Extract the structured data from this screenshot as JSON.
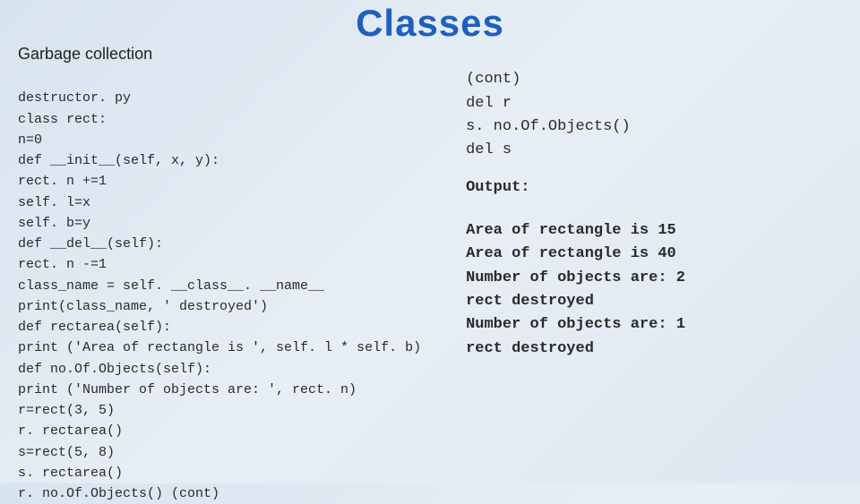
{
  "slide": {
    "title": "Classes"
  },
  "left": {
    "heading": "Garbage collection",
    "code": [
      "destructor. py",
      "class rect:",
      "n=0",
      "def __init__(self, x, y):",
      "rect. n +=1",
      "self. l=x",
      "self. b=y",
      "def __del__(self):",
      "rect. n -=1",
      "class_name = self. __class__. __name__",
      "print(class_name, ' destroyed')",
      "def rectarea(self):",
      "print ('Area of rectangle is ', self. l * self. b)",
      "def no.Of.Objects(self):",
      "print ('Number of objects are: ', rect. n)",
      "r=rect(3, 5)",
      "r. rectarea()",
      "s=rect(5, 8)",
      "s. rectarea()",
      "r. no.Of.Objects() (cont)"
    ]
  },
  "right": {
    "cont": [
      "(cont)",
      "del r",
      "s. no.Of.Objects()",
      "del s"
    ],
    "output_label": "Output:",
    "output": [
      "Area of rectangle is 15",
      "Area of rectangle is 40",
      "Number of objects are: 2",
      "rect destroyed",
      "Number of objects are: 1",
      "rect destroyed"
    ]
  }
}
